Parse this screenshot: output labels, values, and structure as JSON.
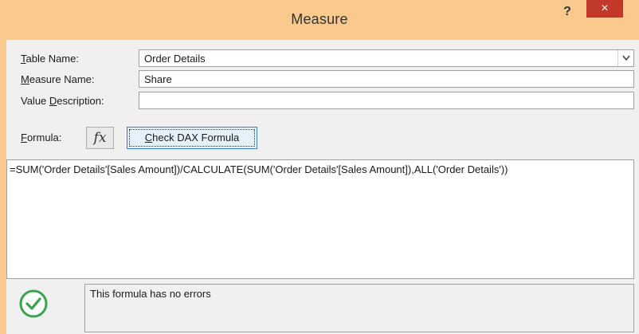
{
  "window": {
    "title": "Measure",
    "help_label": "?",
    "close_label": "×"
  },
  "form": {
    "table_name": {
      "label_prefix": "",
      "label_accel": "T",
      "label_rest": "able Name:",
      "value": "Order Details"
    },
    "measure_name": {
      "label_prefix": "",
      "label_accel": "M",
      "label_rest": "easure Name:",
      "value": "Share"
    },
    "value_description": {
      "label_prefix": "Value ",
      "label_accel": "D",
      "label_rest": "escription:",
      "value": ""
    },
    "formula": {
      "label_prefix": "",
      "label_accel": "F",
      "label_rest": "ormula:",
      "fx_label": "fx",
      "check_prefix": "",
      "check_accel": "C",
      "check_rest": "heck DAX Formula",
      "text": "=SUM('Order Details'[Sales Amount])/CALCULATE(SUM('Order Details'[Sales Amount]),ALL('Order Details'))"
    }
  },
  "status": {
    "icon": "check-circle-icon",
    "message": "This formula has no errors",
    "color": "#3aa44c"
  },
  "colors": {
    "titlebar": "#f9c98d",
    "close": "#c0392b",
    "client": "#f0f0f0"
  }
}
